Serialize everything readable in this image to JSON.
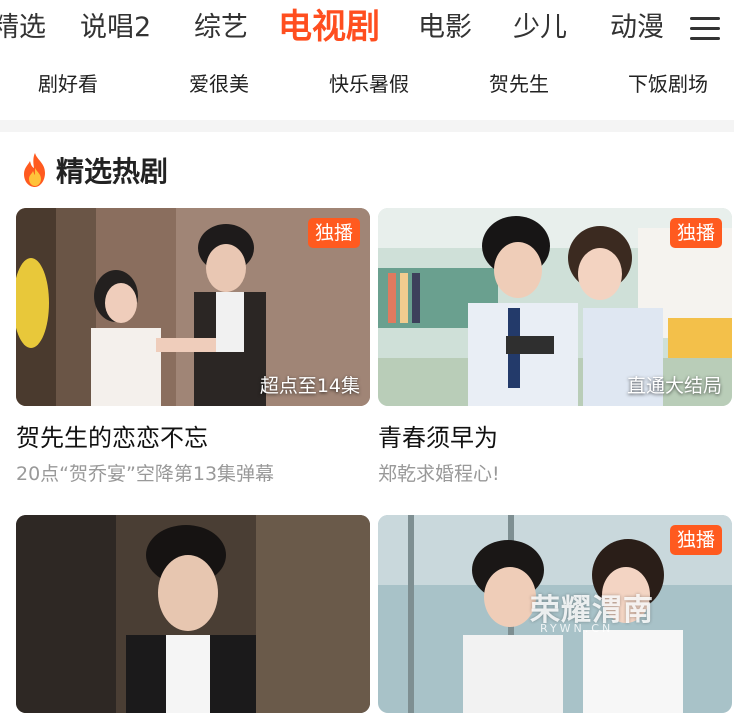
{
  "top_tabs": [
    "精选",
    "说唱2",
    "综艺",
    "电视剧",
    "电影",
    "少儿",
    "动漫"
  ],
  "active_tab": "电视剧",
  "sub_tabs": [
    "剧好看",
    "爱很美",
    "快乐暑假",
    "贺先生",
    "下饭剧场"
  ],
  "section": {
    "title": "精选热剧",
    "icon": "fire-icon"
  },
  "cards": [
    {
      "title": "贺先生的恋恋不忘",
      "subtitle": "20点“贺乔宴”空降第13集弹幕",
      "badge": "独播",
      "overlay": "超点至14集"
    },
    {
      "title": "青春须早为",
      "subtitle": "郑乾求婚程心!",
      "badge": "独播",
      "overlay": "直通大结局"
    },
    {
      "title": "",
      "subtitle": "",
      "badge": "",
      "overlay": ""
    },
    {
      "title": "",
      "subtitle": "",
      "badge": "独播",
      "overlay": ""
    }
  ],
  "watermark": {
    "text": "荣耀渭南",
    "url": "RYWN.CN"
  },
  "colors": {
    "accent": "#ff4e1f",
    "badge": "#ff5a1f",
    "text": "#222222",
    "muted": "#999999"
  }
}
